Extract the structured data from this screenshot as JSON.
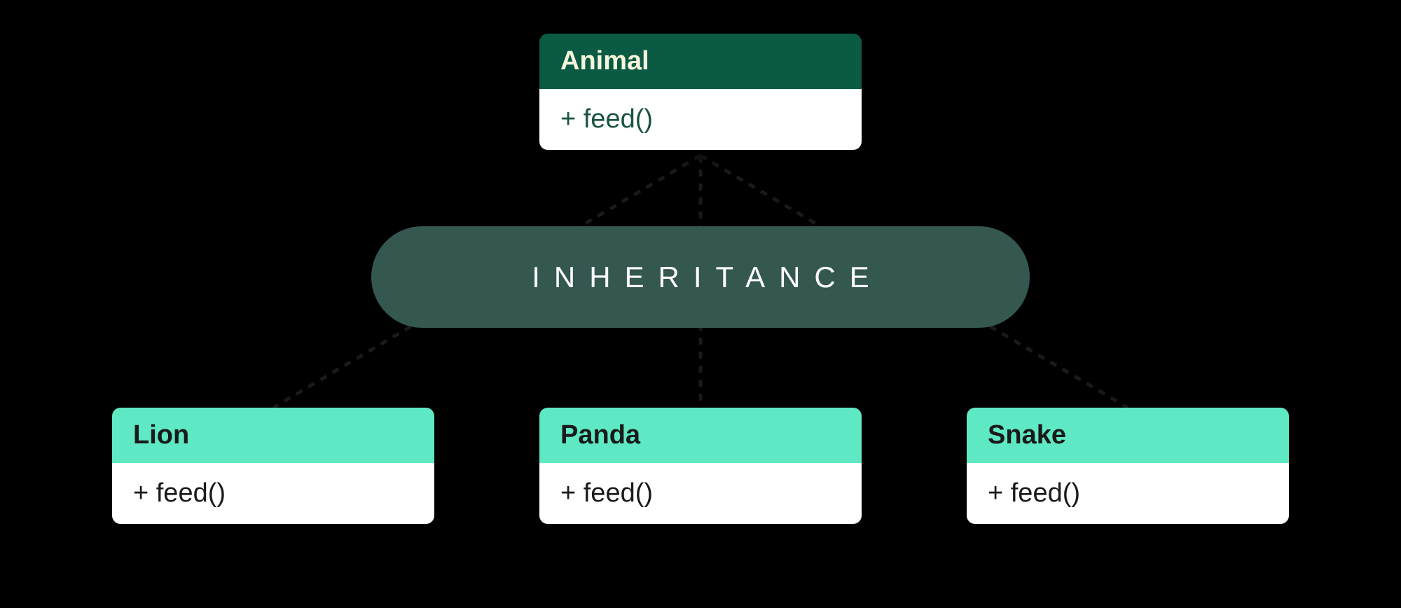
{
  "parent": {
    "name": "Animal",
    "method": "+ feed()"
  },
  "relationship_label": "INHERITANCE",
  "children": [
    {
      "name": "Lion",
      "method": "+ feed()"
    },
    {
      "name": "Panda",
      "method": "+ feed()"
    },
    {
      "name": "Snake",
      "method": "+ feed()"
    }
  ]
}
